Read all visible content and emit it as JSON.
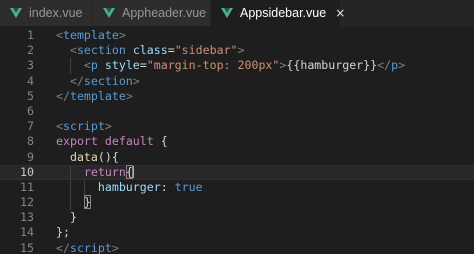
{
  "tabs": [
    {
      "label": "index.vue",
      "icon": "vue-icon",
      "active": false
    },
    {
      "label": "Appheader.vue",
      "icon": "vue-icon",
      "active": false
    },
    {
      "label": "Appsidebar.vue",
      "icon": "vue-icon",
      "active": true,
      "close": "×"
    }
  ],
  "colors": {
    "background": "#1e1e1e",
    "tabbar": "#252526",
    "inactive_tab": "#2d2d2d",
    "vue_green": "#41b883",
    "tag": "#569cd6",
    "attribute": "#9cdcfe",
    "string": "#ce9178",
    "keyword": "#c586c0",
    "function": "#dcdcaa"
  },
  "editor": {
    "current_line": 10,
    "lines": [
      {
        "n": "1",
        "tokens": [
          [
            "punct",
            "<"
          ],
          [
            "tag",
            "template"
          ],
          [
            "punct",
            ">"
          ]
        ]
      },
      {
        "n": "2",
        "tokens": [
          [
            "punct",
            "  <"
          ],
          [
            "tag",
            "section"
          ],
          [
            "text",
            " "
          ],
          [
            "attr",
            "class"
          ],
          [
            "text",
            "="
          ],
          [
            "str",
            "\"sidebar\""
          ],
          [
            "punct",
            ">"
          ]
        ]
      },
      {
        "n": "3",
        "tokens": [
          [
            "punct",
            "    <"
          ],
          [
            "tag",
            "p"
          ],
          [
            "text",
            " "
          ],
          [
            "attr",
            "style"
          ],
          [
            "text",
            "="
          ],
          [
            "str",
            "\"margin-top: 200px\""
          ],
          [
            "punct",
            ">"
          ],
          [
            "text",
            "{{hamburger}}"
          ],
          [
            "punct",
            "</"
          ],
          [
            "tag",
            "p"
          ],
          [
            "punct",
            ">"
          ]
        ]
      },
      {
        "n": "4",
        "tokens": [
          [
            "punct",
            "  </"
          ],
          [
            "tag",
            "section"
          ],
          [
            "punct",
            ">"
          ]
        ]
      },
      {
        "n": "5",
        "tokens": [
          [
            "punct",
            "</"
          ],
          [
            "tag",
            "template"
          ],
          [
            "punct",
            ">"
          ]
        ]
      },
      {
        "n": "6",
        "tokens": []
      },
      {
        "n": "7",
        "tokens": [
          [
            "punct",
            "<"
          ],
          [
            "tag",
            "script"
          ],
          [
            "punct",
            ">"
          ]
        ]
      },
      {
        "n": "8",
        "tokens": [
          [
            "kw",
            "export"
          ],
          [
            "text",
            " "
          ],
          [
            "kw",
            "default"
          ],
          [
            "text",
            " {"
          ]
        ]
      },
      {
        "n": "9",
        "tokens": [
          [
            "text",
            "  "
          ],
          [
            "func",
            "data"
          ],
          [
            "text",
            "(){"
          ]
        ]
      },
      {
        "n": "10",
        "tokens": [
          [
            "text",
            "    "
          ],
          [
            "kw",
            "return"
          ],
          [
            "match",
            "{"
          ]
        ]
      },
      {
        "n": "11",
        "tokens": [
          [
            "text",
            "      "
          ],
          [
            "prop",
            "hamburger"
          ],
          [
            "text",
            ": "
          ],
          [
            "bool",
            "true"
          ]
        ]
      },
      {
        "n": "12",
        "tokens": [
          [
            "text",
            "    "
          ],
          [
            "match",
            "}"
          ]
        ]
      },
      {
        "n": "13",
        "tokens": [
          [
            "text",
            "  }"
          ]
        ]
      },
      {
        "n": "14",
        "tokens": [
          [
            "text",
            "};"
          ]
        ]
      },
      {
        "n": "15",
        "tokens": [
          [
            "punct",
            "</"
          ],
          [
            "tag",
            "script"
          ],
          [
            "punct",
            ">"
          ]
        ]
      }
    ]
  }
}
